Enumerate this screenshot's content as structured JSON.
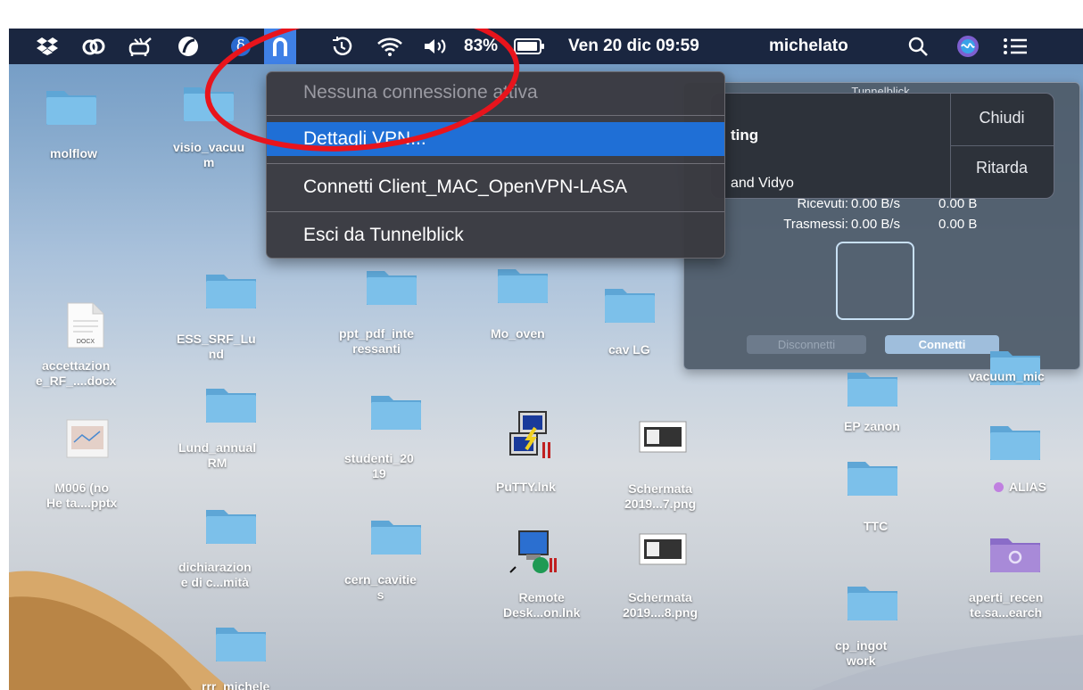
{
  "menubar": {
    "icons": [
      "dropbox-icon",
      "creative-cloud-icon",
      "sheep-icon",
      "app-icon",
      "delta-icon",
      "tunnelblick-icon",
      "time-machine-icon",
      "wifi-icon",
      "volume-icon",
      "battery-icon",
      "search-icon",
      "siri-icon",
      "control-list-icon"
    ],
    "battery": "83%",
    "datetime": "Ven 20 dic 09:59",
    "user": "michelato"
  },
  "vpn_menu": {
    "status": "Nessuna connessione attiva",
    "items": [
      "Dettagli VPN...",
      "Connetti Client_MAC_OpenVPN-LASA",
      "Esci da Tunnelblick"
    ],
    "highlighted": "Dettagli VPN..."
  },
  "tunnelblick_window": {
    "title": "Tunnelblick",
    "received_label": "Ricevuti:",
    "received_rate": "0.00 B/s",
    "received_total": "0.00 B",
    "sent_label": "Trasmessi:",
    "sent_rate": "0.00 B/s",
    "sent_total": "0.00 B",
    "disconnect_button": "Disconnetti",
    "connect_button": "Connetti"
  },
  "notification": {
    "line1": "ting",
    "line2": "and Vidyo",
    "close_button": "Chiudi",
    "snooze_button": "Ritarda"
  },
  "desktop_items": [
    {
      "id": "molflow",
      "label": "molflow"
    },
    {
      "id": "visio",
      "label": "visio_vacuu\nm"
    },
    {
      "id": "docx",
      "label": "accettazion\ne_RF_....docx",
      "badge": "DOCX"
    },
    {
      "id": "ess",
      "label": "ESS_SRF_Lu\nnd"
    },
    {
      "id": "ppt",
      "label": "ppt_pdf_inte\nressanti"
    },
    {
      "id": "mo_oven",
      "label": "Mo_oven"
    },
    {
      "id": "cav",
      "label": "cav LG"
    },
    {
      "id": "vacuum",
      "label": "vacuum_mic"
    },
    {
      "id": "lund",
      "label": "Lund_annual\nRM"
    },
    {
      "id": "studenti",
      "label": "studenti_20\n19"
    },
    {
      "id": "putty",
      "label": "PuTTY.lnk"
    },
    {
      "id": "scherm1",
      "label": "Schermata\n2019...7.png"
    },
    {
      "id": "ep",
      "label": "EP zanon"
    },
    {
      "id": "alias",
      "label": "ALIAS"
    },
    {
      "id": "m006",
      "label": "M006 (no\nHe ta....pptx"
    },
    {
      "id": "ttc",
      "label": "TTC"
    },
    {
      "id": "dichiar",
      "label": "dichiarazion\ne di c...mità"
    },
    {
      "id": "cern",
      "label": "cern_cavitie\ns"
    },
    {
      "id": "remote",
      "label": "Remote\nDesk...on.lnk"
    },
    {
      "id": "scherm2",
      "label": "Schermata\n2019....8.png"
    },
    {
      "id": "aperti",
      "label": "aperti_recen\nte.sa...earch"
    },
    {
      "id": "cp",
      "label": "cp_ingot\nwork"
    },
    {
      "id": "rrr",
      "label": "rrr_michele"
    }
  ],
  "colors": {
    "menubar": "#121c34",
    "highlight": "#1f6fd6",
    "annotation": "#e8141c",
    "folder": "#6fb4e0"
  }
}
